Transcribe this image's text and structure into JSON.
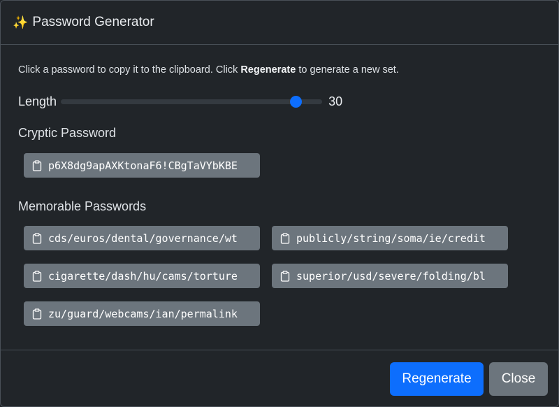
{
  "dialog": {
    "title_icon": "✨",
    "title": "Password Generator",
    "hint_prefix": "Click a password to copy it to the clipboard. Click ",
    "hint_bold": "Regenerate",
    "hint_suffix": " to generate a new set.",
    "length_label": "Length",
    "length_value": "30",
    "length_min": 8,
    "length_max": 32,
    "cryptic_label": "Cryptic Password",
    "cryptic_password": "p6X8dg9apAXKtonaF6!CBgTaVYbKBE",
    "memorable_label": "Memorable Passwords",
    "memorable": [
      "cds/euros/dental/governance/wt",
      "publicly/string/soma/ie/credit",
      "cigarette/dash/hu/cams/torture",
      "superior/usd/severe/folding/bl",
      "zu/guard/webcams/ian/permalink"
    ],
    "regenerate_label": "Regenerate",
    "close_label": "Close",
    "colors": {
      "primary": "#0d6efd",
      "secondary": "#6c757d",
      "background": "#212529"
    },
    "icons": {
      "title": "sparkles-icon",
      "password_button": "clipboard-icon"
    }
  }
}
